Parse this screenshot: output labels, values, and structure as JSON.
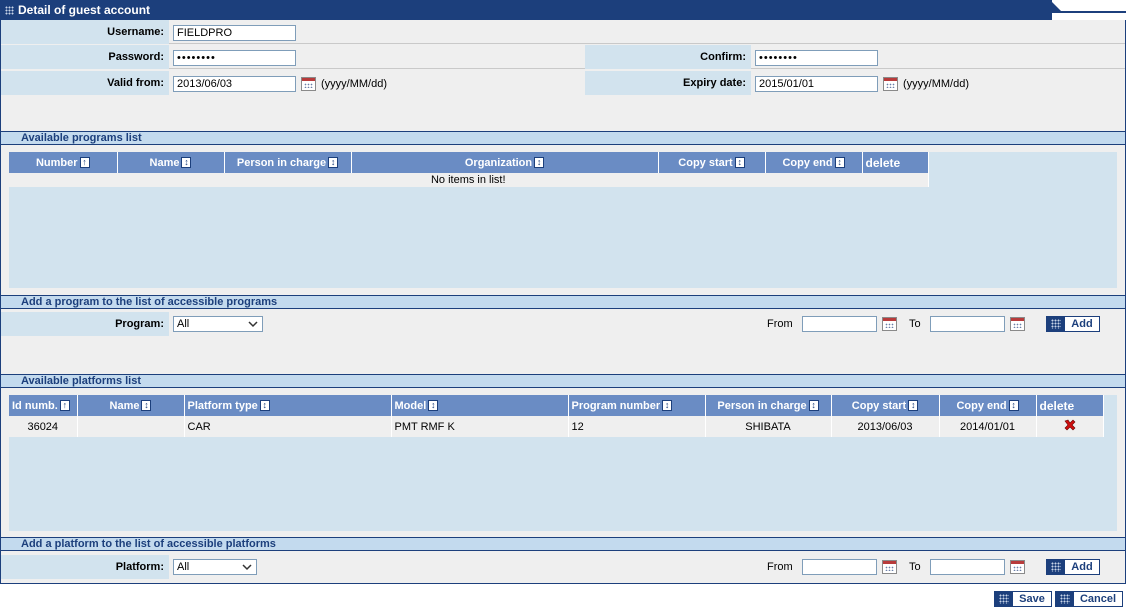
{
  "header": {
    "title": "Detail of guest account"
  },
  "account": {
    "username_label": "Username:",
    "username": "FIELDPRO",
    "password_label": "Password:",
    "password": "••••••••",
    "confirm_label": "Confirm:",
    "confirm": "••••••••",
    "valid_from_label": "Valid from:",
    "valid_from": "2013/06/03",
    "expiry_label": "Expiry date:",
    "expiry": "2015/01/01",
    "date_format": "(yyyy/MM/dd)"
  },
  "programs": {
    "section_title": "Available programs list",
    "columns": [
      "Number",
      "Name",
      "Person in charge",
      "Organization",
      "Copy start",
      "Copy end",
      "delete"
    ],
    "empty_text": "No items in list!"
  },
  "add_program": {
    "section_title": "Add a program to the list of accessible programs",
    "label": "Program:",
    "selected": "All",
    "from_label": "From",
    "to_label": "To",
    "add_label": "Add"
  },
  "platforms": {
    "section_title": "Available platforms list",
    "columns": [
      "Id numb.",
      "Name",
      "Platform type",
      "Model",
      "Program number",
      "Person in charge",
      "Copy start",
      "Copy end",
      "delete"
    ],
    "rows": [
      {
        "id": "36024",
        "name": "",
        "type": "CAR",
        "model": "PMT RMF K",
        "program": "12",
        "person": "SHIBATA",
        "copy_start": "2013/06/03",
        "copy_end": "2014/01/01"
      }
    ]
  },
  "add_platform": {
    "section_title": "Add a platform to the list of accessible platforms",
    "label": "Platform:",
    "selected": "All",
    "from_label": "From",
    "to_label": "To",
    "add_label": "Add"
  },
  "footer": {
    "save_label": "Save",
    "cancel_label": "Cancel"
  },
  "colors": {
    "primary": "#1c3f7c",
    "header_col": "#6a8cc4",
    "label_bg": "#d2e3ee",
    "delete_red": "#d01010"
  },
  "icons": {
    "calendar": "calendar-icon",
    "sort": "sort-icon",
    "delete": "delete-x-icon"
  }
}
